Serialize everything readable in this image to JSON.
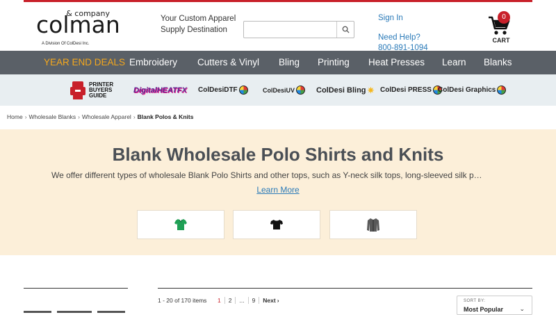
{
  "logo": {
    "company": "& company",
    "name": "colman",
    "division": "A Division Of ColDesi Inc."
  },
  "header": {
    "tagline": "Your Custom Apparel Supply Destination",
    "search_placeholder": "",
    "sign_in": "Sign In",
    "need_help": "Need Help?",
    "phone": "800-891-1094",
    "cart_label": "CART",
    "cart_count": "0"
  },
  "nav": {
    "items": [
      {
        "label": "YEAR END DEALS"
      },
      {
        "label": "Embroidery"
      },
      {
        "label": "Cutters & Vinyl"
      },
      {
        "label": "Bling"
      },
      {
        "label": "Printing"
      },
      {
        "label": "Heat Presses"
      },
      {
        "label": "Learn"
      },
      {
        "label": "Blanks"
      }
    ]
  },
  "brands": {
    "items": [
      {
        "label": "PRINTER BUYERS GUIDE",
        "icon": "printer-buyers-guide-logo"
      },
      {
        "label": "DigitalHEATFX",
        "icon": "digital-heat-fx-logo"
      },
      {
        "label": "ColDesiDTF",
        "icon": "coldesi-dtf-logo"
      },
      {
        "label": "ColDesiUV",
        "icon": "coldesi-uv-logo"
      },
      {
        "label": "ColDesi Bling",
        "icon": "coldesi-bling-logo"
      },
      {
        "label": "ColDesi PRESS",
        "icon": "coldesi-press-logo"
      },
      {
        "label": "ColDesi Graphics",
        "icon": "coldesi-graphics-logo"
      }
    ]
  },
  "breadcrumb": {
    "items": [
      "Home",
      "Wholesale Blanks",
      "Wholesale Apparel"
    ],
    "current": "Blank Polos & Knits"
  },
  "hero": {
    "title": "Blank Wholesale Polo Shirts and Knits",
    "description": "We offer different types of wholesale Blank Polo Shirts and other tops, such as Y-neck silk tops, long-sleeved silk p…",
    "learn_more": "Learn More",
    "categories": [
      {
        "icon": "green-polo-icon",
        "color": "#1fa055"
      },
      {
        "icon": "black-tshirt-icon",
        "color": "#111111"
      },
      {
        "icon": "gray-jacket-icon",
        "color": "#5a5a5a"
      }
    ]
  },
  "results": {
    "count": "1 - 20 of 170 items",
    "pages": [
      "1",
      "2",
      "...",
      "9"
    ],
    "next": "Next",
    "sort_label": "SORT BY:",
    "sort_value": "Most Popular"
  },
  "colors": {
    "accent_red": "#c8202a",
    "nav_bg": "#5a6067",
    "deal_orange": "#f5a81c",
    "link_blue": "#2a7ab8",
    "hero_bg": "#fcefd9"
  }
}
